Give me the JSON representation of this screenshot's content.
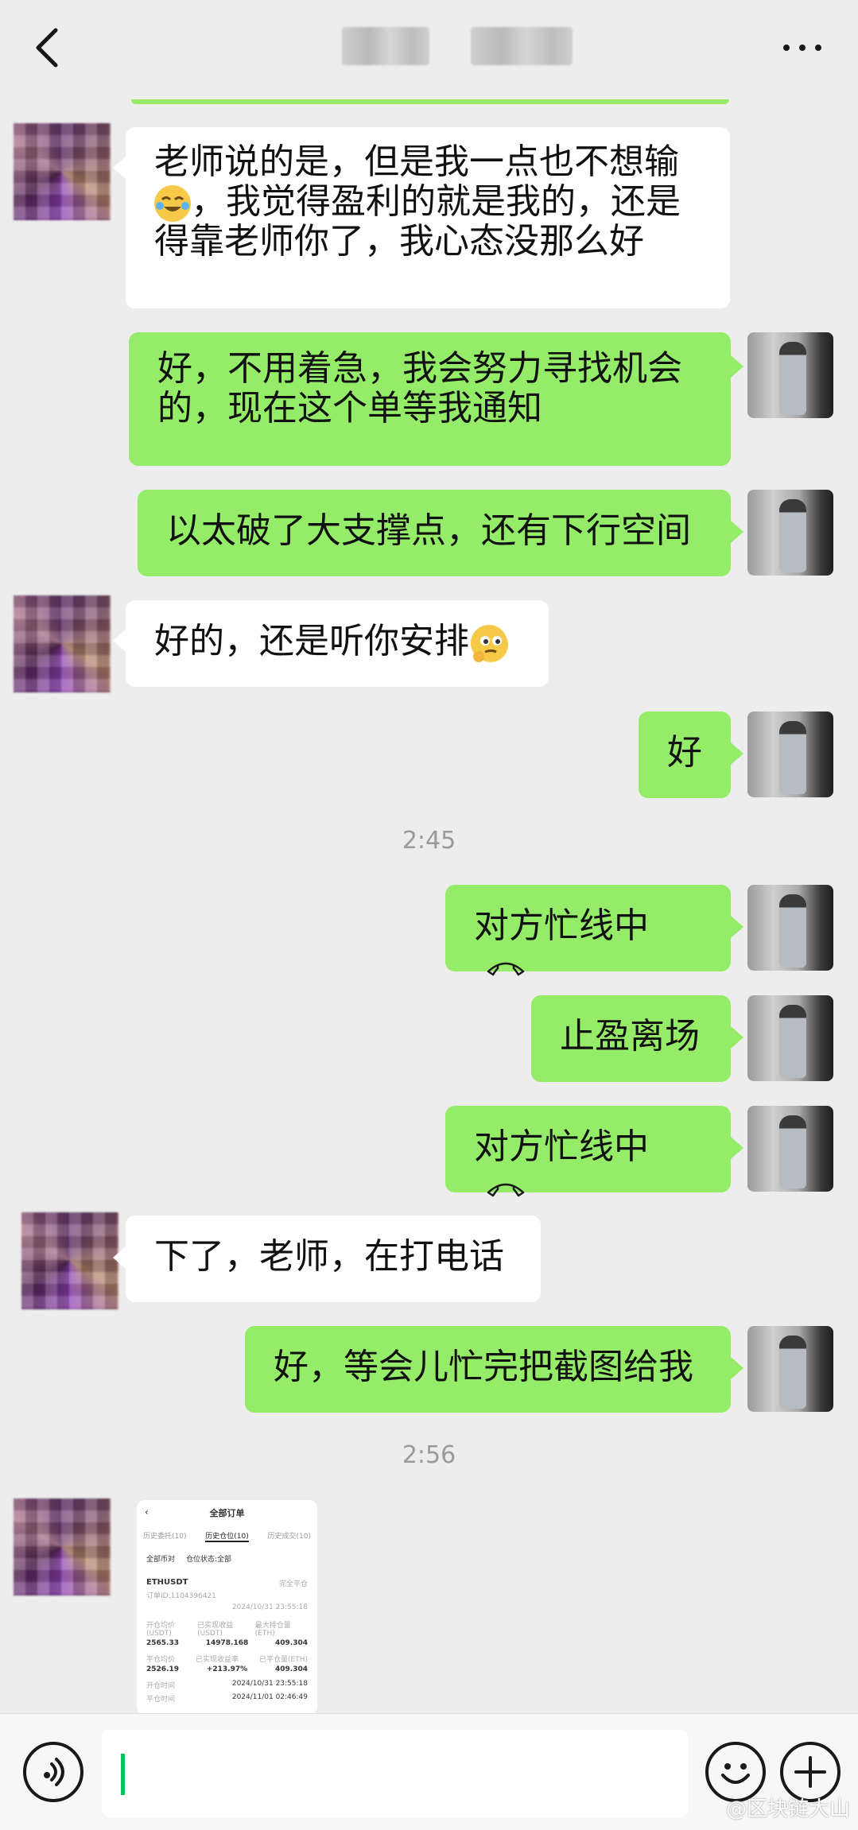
{
  "header": {
    "title_hidden": true
  },
  "messages": {
    "m1": "老师说的是，但是我一点也不想输",
    "m1b": "，我觉得盈利的就是我的，还是",
    "m1c": "得靠老师你了，我心态没那么好",
    "m2a": "好，不用着急，我会努力寻找机会",
    "m2b": "的，现在这个单等我通知",
    "m3": "以太破了大支撑点，还有下行空间",
    "m4": "好的，还是听你安排",
    "m5": "好",
    "t1": "2:45",
    "m6": "对方忙线中",
    "m7": "止盈离场",
    "m8": "对方忙线中",
    "m9": "下了，老师，在打电话",
    "m10": "好，等会儿忙完把截图给我",
    "t2": "2:56"
  },
  "screenshot": {
    "title": "全部订单",
    "tabs": [
      "历史委托(10)",
      "历史仓位(10)",
      "历史成交(10)"
    ],
    "filters": [
      "全部币对",
      "仓位状态:全部"
    ],
    "pair": "ETHUSDT",
    "status": "完全平仓",
    "order_id": "订单ID:1104396421",
    "open_time": "2024/10/31 23:55:18",
    "rows": [
      {
        "label_a": "开仓均价(USDT)",
        "value_a": "2565.33",
        "label_b": "已实现收益(USDT)",
        "value_b": "14978.168",
        "label_c": "最大持仓量(ETH)",
        "value_c": "409.304"
      },
      {
        "label_a": "平仓均价",
        "value_a": "2526.19",
        "label_b": "已实现收益率",
        "value_b": "+213.97%",
        "label_c": "已平仓量(ETH)",
        "value_c": "409.304"
      }
    ],
    "open_label": "开仓时间",
    "open_value": "2024/10/31 23:55:18",
    "close_label": "平仓时间",
    "close_value": "2024/11/01 02:46:49"
  },
  "watermark": "@区块链大山",
  "colors": {
    "self_bubble": "#95ec69",
    "other_bubble": "#ffffff",
    "background": "#ededed"
  }
}
